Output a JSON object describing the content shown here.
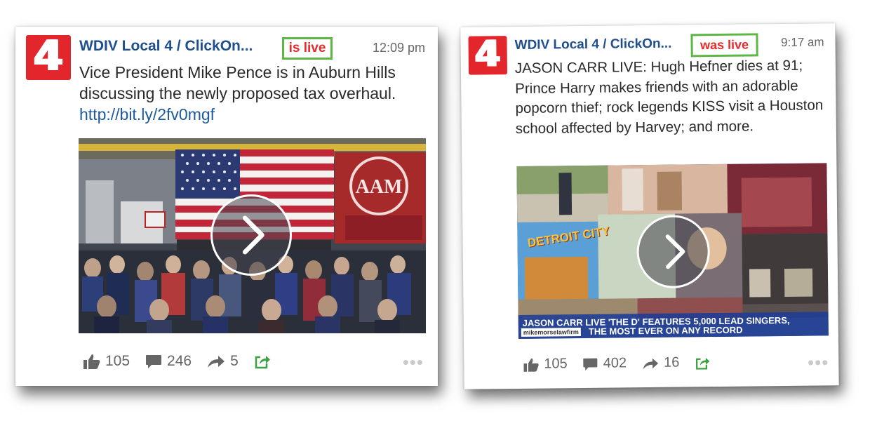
{
  "posts": [
    {
      "page_name": "WDIV Local 4 / ClickOn...",
      "live_status": "is live",
      "time": "12:09 pm",
      "text": "Vice President Mike Pence is in Auburn Hills discussing the newly proposed tax overhaul.",
      "link": "http://bit.ly/2fv0mgf",
      "logo_text": "4",
      "likes": "105",
      "comments": "246",
      "shares": "5",
      "more": "•••",
      "media_sign": "AAM"
    },
    {
      "page_name": "WDIV Local 4 / ClickOn...",
      "live_status": "was live",
      "time": "9:17 am",
      "text": "JASON CARR LIVE: Hugh Hefner dies at 91; Prince Harry makes friends with an adorable popcorn thief; rock legends KISS visit a Houston school affected by Harvey; and more.",
      "link": "",
      "logo_text": "4",
      "likes": "105",
      "comments": "402",
      "shares": "16",
      "more": "•••",
      "media_sign": "DETROIT CITY",
      "caption_line_1": "JASON CARR LIVE 'THE D' FEATURES 5,000 LEAD SINGERS,",
      "caption_line_2": "THE MOST EVER ON ANY RECORD",
      "caption_logo": "mikemorselawfirm"
    }
  ],
  "colors": {
    "brand_red": "#e2262c",
    "page_name_blue": "#1f4f8f",
    "badge_border_green": "#5cb744",
    "badge_text_red": "#e52b2b",
    "share_icon_green": "#3aa141"
  },
  "icons": [
    "thumbs-up-icon",
    "comment-icon",
    "share-arrow-icon",
    "share-box-icon",
    "more-dots-icon",
    "play-icon"
  ]
}
